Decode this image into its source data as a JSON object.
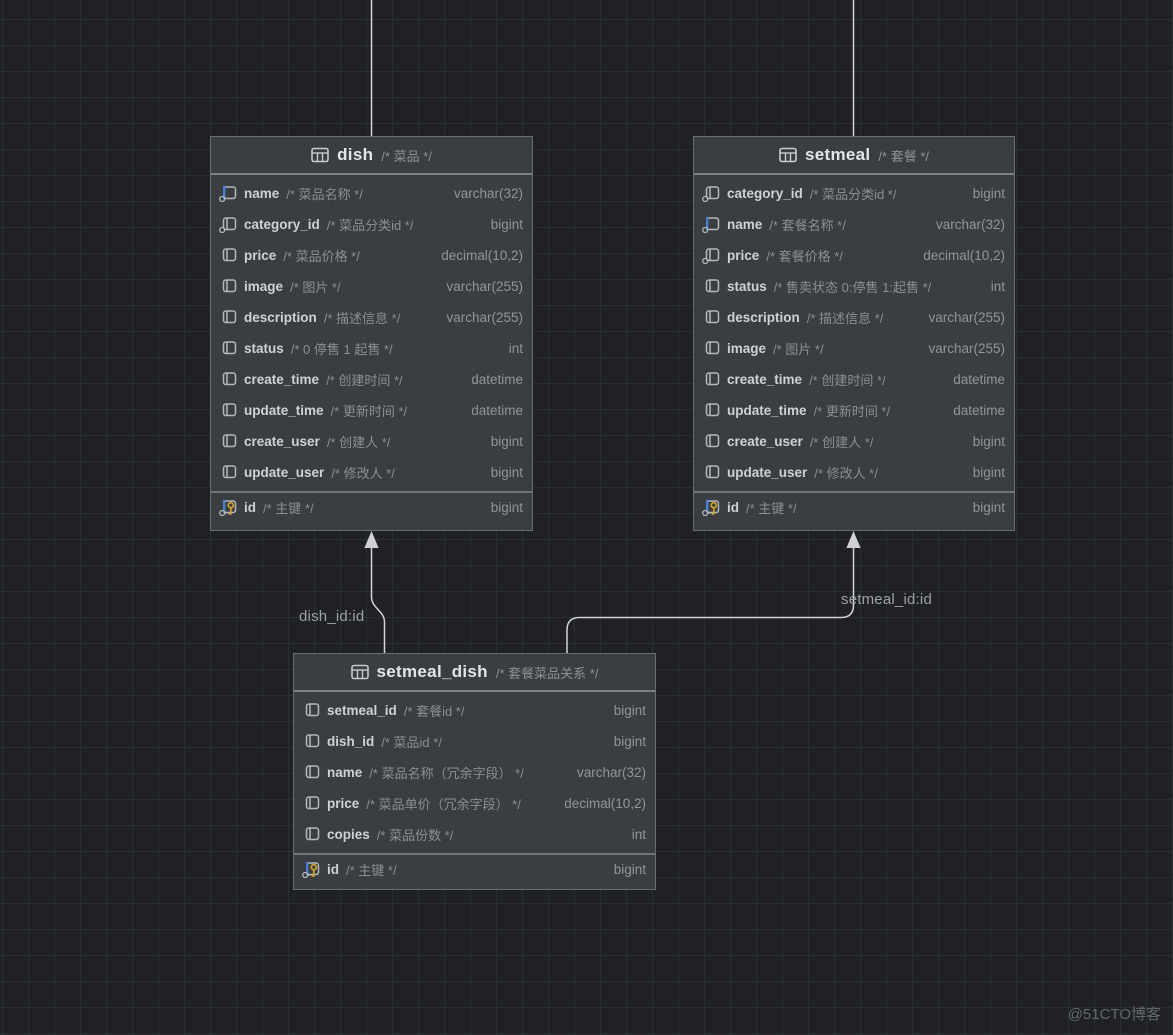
{
  "diagram": {
    "tables": [
      {
        "id": "dish",
        "name": "dish",
        "comment": "/* 菜品 */",
        "columns": [
          {
            "name": "name",
            "comment": "/* 菜品名称 */",
            "type": "varchar(32)",
            "icon": "indexed-blue"
          },
          {
            "name": "category_id",
            "comment": "/* 菜品分类id */",
            "type": "bigint",
            "icon": "indexed"
          },
          {
            "name": "price",
            "comment": "/* 菜品价格 */",
            "type": "decimal(10,2)",
            "icon": "plain"
          },
          {
            "name": "image",
            "comment": "/* 图片 */",
            "type": "varchar(255)",
            "icon": "plain"
          },
          {
            "name": "description",
            "comment": "/* 描述信息 */",
            "type": "varchar(255)",
            "icon": "plain"
          },
          {
            "name": "status",
            "comment": "/* 0 停售 1 起售 */",
            "type": "int",
            "icon": "plain"
          },
          {
            "name": "create_time",
            "comment": "/* 创建时间 */",
            "type": "datetime",
            "icon": "plain"
          },
          {
            "name": "update_time",
            "comment": "/* 更新时间 */",
            "type": "datetime",
            "icon": "plain"
          },
          {
            "name": "create_user",
            "comment": "/* 创建人 */",
            "type": "bigint",
            "icon": "plain"
          },
          {
            "name": "update_user",
            "comment": "/* 修改人 */",
            "type": "bigint",
            "icon": "plain"
          },
          {
            "name": "id",
            "comment": "/* 主键 */",
            "type": "bigint",
            "icon": "pk"
          }
        ]
      },
      {
        "id": "setmeal",
        "name": "setmeal",
        "comment": "/* 套餐 */",
        "columns": [
          {
            "name": "category_id",
            "comment": "/* 菜品分类id */",
            "type": "bigint",
            "icon": "indexed"
          },
          {
            "name": "name",
            "comment": "/* 套餐名称 */",
            "type": "varchar(32)",
            "icon": "indexed-blue"
          },
          {
            "name": "price",
            "comment": "/* 套餐价格 */",
            "type": "decimal(10,2)",
            "icon": "indexed"
          },
          {
            "name": "status",
            "comment": "/* 售卖状态 0:停售 1:起售 */",
            "type": "int",
            "icon": "plain"
          },
          {
            "name": "description",
            "comment": "/* 描述信息 */",
            "type": "varchar(255)",
            "icon": "plain"
          },
          {
            "name": "image",
            "comment": "/* 图片 */",
            "type": "varchar(255)",
            "icon": "plain"
          },
          {
            "name": "create_time",
            "comment": "/* 创建时间 */",
            "type": "datetime",
            "icon": "plain"
          },
          {
            "name": "update_time",
            "comment": "/* 更新时间 */",
            "type": "datetime",
            "icon": "plain"
          },
          {
            "name": "create_user",
            "comment": "/* 创建人 */",
            "type": "bigint",
            "icon": "plain"
          },
          {
            "name": "update_user",
            "comment": "/* 修改人 */",
            "type": "bigint",
            "icon": "plain"
          },
          {
            "name": "id",
            "comment": "/* 主键 */",
            "type": "bigint",
            "icon": "pk"
          }
        ]
      },
      {
        "id": "setmeal_dish",
        "name": "setmeal_dish",
        "comment": "/* 套餐菜品关系 */",
        "columns": [
          {
            "name": "setmeal_id",
            "comment": "/* 套餐id */",
            "type": "bigint",
            "icon": "plain"
          },
          {
            "name": "dish_id",
            "comment": "/* 菜品id */",
            "type": "bigint",
            "icon": "plain"
          },
          {
            "name": "name",
            "comment": "/* 菜品名称（冗余字段） */",
            "type": "varchar(32)",
            "icon": "plain"
          },
          {
            "name": "price",
            "comment": "/* 菜品单价（冗余字段） */",
            "type": "decimal(10,2)",
            "icon": "plain"
          },
          {
            "name": "copies",
            "comment": "/* 菜品份数 */",
            "type": "int",
            "icon": "plain"
          },
          {
            "name": "id",
            "comment": "/* 主键 */",
            "type": "bigint",
            "icon": "pk"
          }
        ]
      }
    ],
    "relationships": [
      {
        "label": "dish_id:id"
      },
      {
        "label": "setmeal_id:id"
      }
    ],
    "watermark": "@51CTO博客",
    "colors": {
      "background": "#1f2125",
      "grid_line": "#2b2e32",
      "table_fill": "#3b3e41",
      "table_border": "#6b6e71",
      "accent_blue": "#4a7ed2",
      "key_gold": "#cfa42a",
      "wire": "#d2d4d6"
    }
  }
}
